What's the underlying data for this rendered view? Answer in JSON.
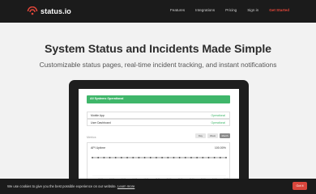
{
  "header": {
    "logo_text": "status.io",
    "nav": [
      "Features",
      "Integrations",
      "Pricing",
      "Sign in"
    ],
    "cta": "Get Started",
    "accent": "#e5473a"
  },
  "hero": {
    "title": "System Status and Incidents Made Simple",
    "subtitle": "Customizable status pages, real-time incident tracking, and instant notifications"
  },
  "screen": {
    "banner": "All Systems Operational",
    "components": [
      {
        "name": "Mobile App",
        "status": "Operational"
      },
      {
        "name": "User Dashboard",
        "status": "Operational"
      }
    ],
    "metrics_label": "Metrics",
    "ranges": [
      "Day",
      "Week",
      "Month"
    ],
    "active_range": "Month",
    "metric": {
      "title": "API Uptime",
      "value": "100.00%"
    },
    "status_color": "#3fb66a"
  },
  "chart_data": {
    "type": "line",
    "title": "API Uptime",
    "x": [
      "08:00",
      "10:00",
      "12:00",
      "14:00",
      "16:00",
      "18:00",
      "20:00",
      "22:00",
      "00:00",
      "02:00",
      "04:00",
      "06:00"
    ],
    "values": [
      100,
      100,
      100,
      100,
      100,
      100,
      100,
      100,
      100,
      100,
      100,
      100,
      100,
      100,
      100,
      100,
      100,
      100,
      100,
      100,
      100,
      100,
      100,
      100
    ],
    "ylim": [
      0,
      100
    ]
  },
  "cookie": {
    "text": "We use cookies to give you the best possible experience on our website.",
    "link": "Learn more",
    "button": "Got it"
  }
}
